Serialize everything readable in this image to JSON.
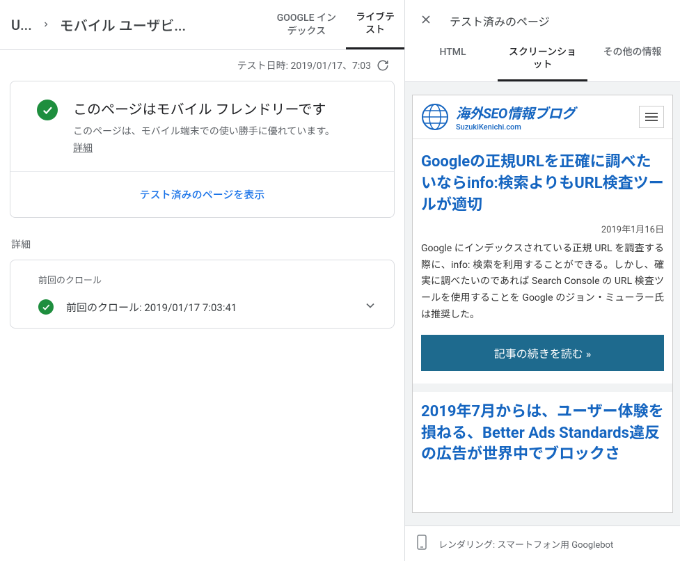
{
  "breadcrumb": {
    "part1": "U...",
    "part2": "モバイル ユーザビ..."
  },
  "leftTabs": {
    "index": "GOOGLE イン\nデックス",
    "live": "ライブテ\nスト"
  },
  "testTime": {
    "label": "テスト日時: 2019/01/17、7:03"
  },
  "status": {
    "title": "このページはモバイル フレンドリーです",
    "desc": "このページは、モバイル端末での使い勝手に優れています。",
    "details": "詳細"
  },
  "cardAction": "テスト済みのページを表示",
  "detailsSection": "詳細",
  "crawl": {
    "label": "前回のクロール",
    "value": "前回のクロール: 2019/01/17 7:03:41"
  },
  "rightTitle": "テスト済みのページ",
  "rightTabs": {
    "html": "HTML",
    "screenshot": "スクリーンショ\nット",
    "other": "その他の情報"
  },
  "blog": {
    "siteTitle": "海外SEO情報ブログ",
    "siteSub": "SuzukiKenichi.com",
    "article1": {
      "title": "Googleの正規URLを正確に調べたいならinfo:検索よりもURL検査ツールが適切",
      "date": "2019年1月16日",
      "body": "Google にインデックスされている正規 URL を調査する際に、info: 検索を利用することができる。しかし、確実に調べたいのであれば Search Console の URL 検査ツールを使用することを Google のジョン・ミューラー氏は推奨した。",
      "readMore": "記事の続きを読む »"
    },
    "article2": {
      "title": "2019年7月からは、ユーザー体験を損ねる、Better Ads Standards違反の広告が世界中でブロックさ"
    }
  },
  "renderFooter": "レンダリング: スマートフォン用 Googlebot"
}
